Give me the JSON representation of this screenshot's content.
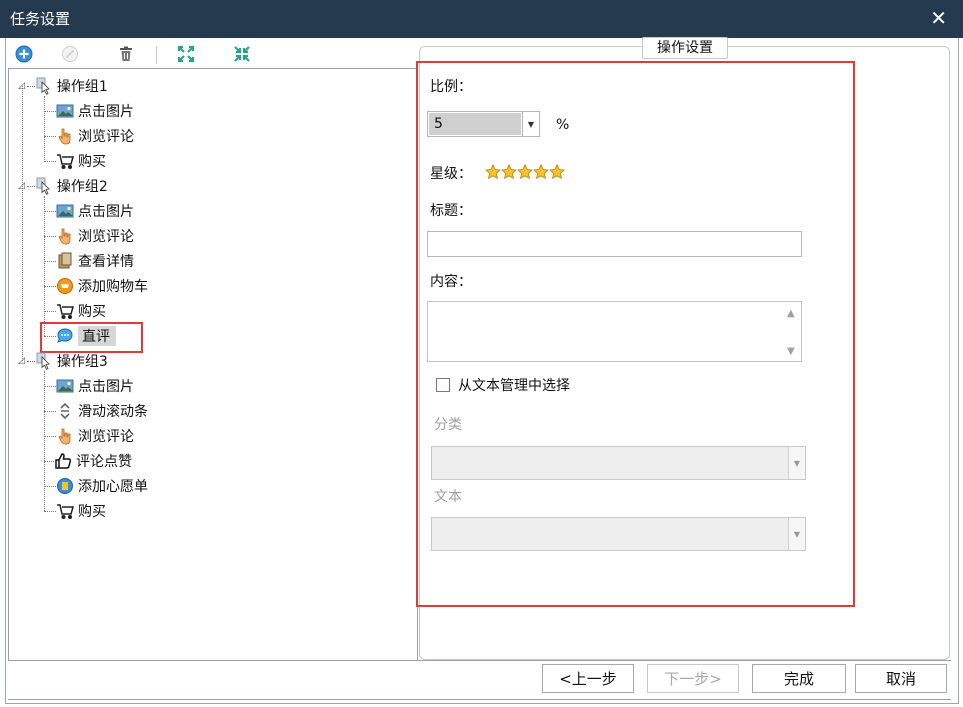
{
  "window": {
    "title": "任务设置",
    "close_glyph": "✕"
  },
  "toolbar": {
    "icons": [
      "add-icon",
      "disable-icon",
      "delete-icon",
      "expand-all-icon",
      "collapse-all-icon"
    ]
  },
  "tree": {
    "groups": [
      {
        "label": "操作组1",
        "items": [
          {
            "label": "点击图片",
            "icon": "image-icon"
          },
          {
            "label": "浏览评论",
            "icon": "hand-pointer-icon"
          },
          {
            "label": "购买",
            "icon": "cart-icon"
          }
        ]
      },
      {
        "label": "操作组2",
        "items": [
          {
            "label": "点击图片",
            "icon": "image-icon"
          },
          {
            "label": "浏览评论",
            "icon": "hand-pointer-icon"
          },
          {
            "label": "查看详情",
            "icon": "details-icon"
          },
          {
            "label": "添加购物车",
            "icon": "add-cart-icon"
          },
          {
            "label": "购买",
            "icon": "cart-icon"
          },
          {
            "label": "直评",
            "icon": "comment-bubble-icon",
            "selected": true
          }
        ]
      },
      {
        "label": "操作组3",
        "items": [
          {
            "label": "点击图片",
            "icon": "image-icon"
          },
          {
            "label": "滑动滚动条",
            "icon": "scroll-icon"
          },
          {
            "label": "浏览评论",
            "icon": "hand-pointer-icon"
          },
          {
            "label": "评论点赞",
            "icon": "thumbs-up-icon"
          },
          {
            "label": "添加心愿单",
            "icon": "wishlist-icon"
          },
          {
            "label": "购买",
            "icon": "cart-icon"
          }
        ]
      }
    ]
  },
  "settings": {
    "group_title": "操作设置",
    "ratio_label": "比例：",
    "ratio_value": "5",
    "ratio_unit": "%",
    "star_label": "星级：",
    "star_rating": 5,
    "star_max": 5,
    "title_label": "标题：",
    "title_value": "",
    "content_label": "内容：",
    "content_value": "",
    "from_text_label": "从文本管理中选择",
    "from_text_checked": false,
    "category_label": "分类",
    "category_value": "",
    "text_label": "文本",
    "text_value": ""
  },
  "footer": {
    "prev": "<上一步",
    "next": "下一步>",
    "finish": "完成",
    "cancel": "取消"
  },
  "colors": {
    "titlebar": "#253a4f",
    "highlight_box": "#e03a3a",
    "star": "#f2c230"
  }
}
